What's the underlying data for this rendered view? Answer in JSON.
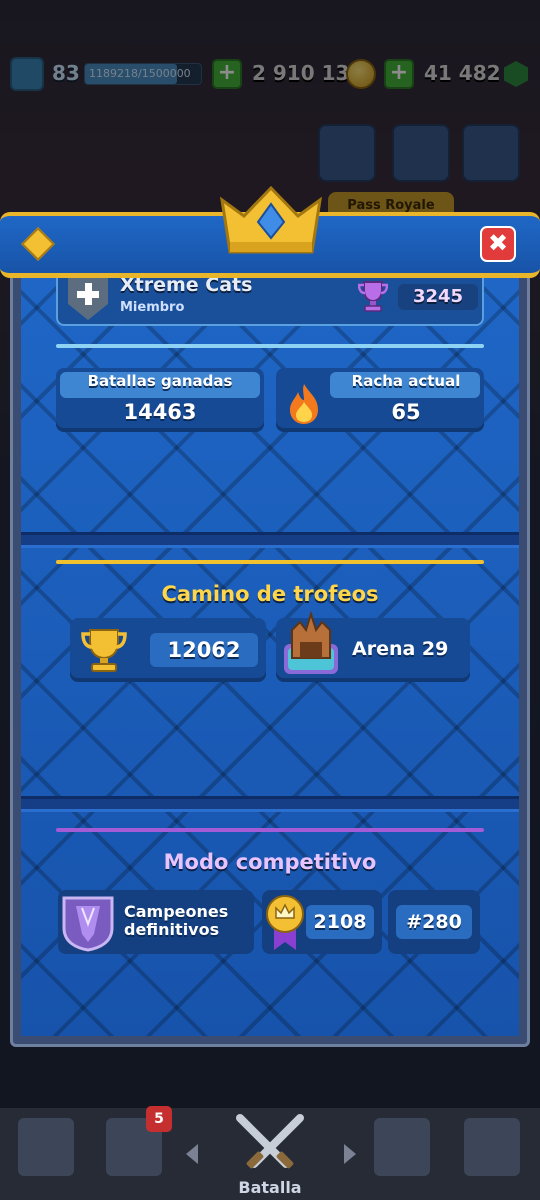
{
  "topbar": {
    "level": "83",
    "xp": "1189218/1500000",
    "xp_progress": 0.79,
    "gold": "2 910 135",
    "gems": "41 482"
  },
  "header": {
    "pass_label": "Pass Royale",
    "friends_count": "5"
  },
  "clan": {
    "name": "Xtreme Cats",
    "role": "Miembro",
    "trophies": "3245"
  },
  "stats": {
    "wins_label": "Batallas ganadas",
    "wins_value": "14463",
    "streak_label": "Racha actual",
    "streak_value": "65"
  },
  "trophy_road": {
    "title": "Camino de trofeos",
    "trophies": "12062",
    "arena": "Arena 29"
  },
  "ranked": {
    "title": "Modo competitivo",
    "league_line1": "Campeones",
    "league_line2": "definitivos",
    "rating": "2108",
    "rank": "#280"
  },
  "bottom_nav": {
    "active_label": "Batalla",
    "cards_badge": "5"
  },
  "colors": {
    "gold": "#e9b52a",
    "modal_blue": "#1c5eb9",
    "trophy_title": "#ffd54a",
    "ranked_title": "#e7c4ff",
    "divider_trophy": "#f2c12e",
    "divider_ranked": "#a35bd6",
    "divider_clan": "#8fd3f4"
  }
}
